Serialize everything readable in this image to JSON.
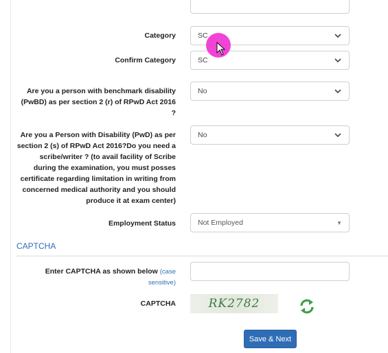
{
  "form": {
    "category": {
      "label": "Category",
      "value": "SC"
    },
    "confirm_category": {
      "label": "Confirm Category",
      "value": "SC"
    },
    "pwbd": {
      "label_lines": [
        "Are you a person with benchmark disability",
        "(PwBD) as per section 2 (r) of RPwD Act 2016",
        "?"
      ],
      "value": "No"
    },
    "pwd_scribe": {
      "label_lines": [
        "Are you a Person with Disability (PwD) as per",
        "section 2 (s) of RPwD Act 2016?Do you need a",
        "scribe/writer ? (to avail facility of Scribe",
        "during the examination, you must posses",
        "certificate regarding limitation in writing from",
        "concerned medical authority and you should",
        "produce it at exam center)"
      ],
      "value": "No"
    },
    "employment_status": {
      "label": "Employment Status",
      "value": "Not Employed"
    }
  },
  "captcha_section": {
    "title": "CAPTCHA",
    "enter_label": "Enter CAPTCHA as shown below",
    "enter_hint_line1": "(case",
    "enter_hint_line2": "sensitive)",
    "captcha_label": "CAPTCHA",
    "captcha_text": "RK2782"
  },
  "actions": {
    "submit_label": "Save & Next"
  },
  "icons": {
    "dropdown": "chevron-down-icon",
    "refresh": "refresh-icon",
    "cursor": "mouse-pointer-icon"
  },
  "colors": {
    "accent": "#2c6fb5",
    "button": "#2f6db5",
    "cursor_highlight": "#f12fd3",
    "captcha_text": "#3c7a43",
    "refresh_icon": "#3aa04a"
  }
}
